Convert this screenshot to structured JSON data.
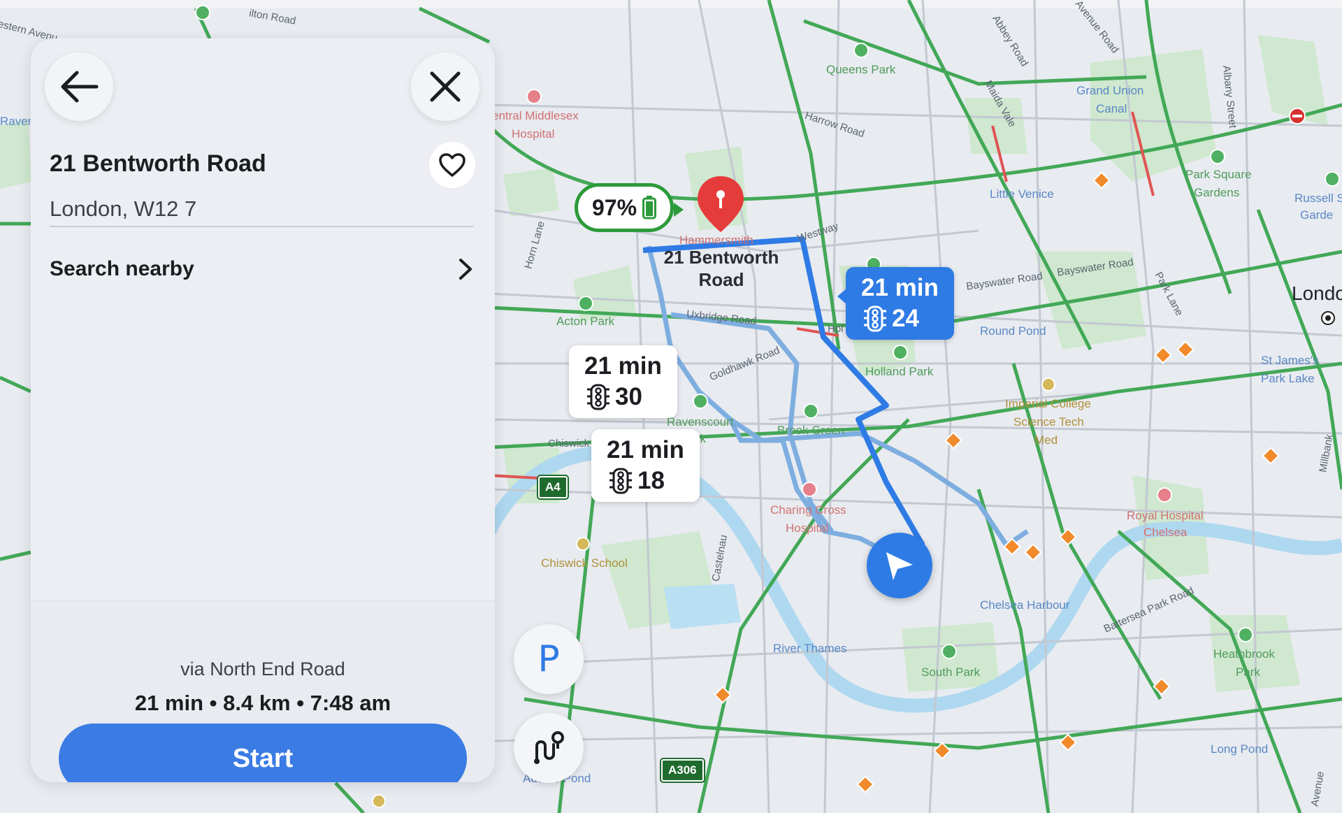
{
  "panel": {
    "address_title": "21 Bentworth Road",
    "address_sub": "London, W12 7",
    "search_nearby": "Search nearby",
    "via": "via North End Road",
    "summary": "21 min • 8.4 km • 7:48 am",
    "start": "Start"
  },
  "icons": {
    "back": "back-arrow-icon",
    "close": "close-icon",
    "favorite": "heart-icon",
    "chevron": "chevron-right-icon",
    "traffic": "traffic-light-icon",
    "parking": "parking-icon",
    "route_options": "route-options-icon",
    "position": "navigation-arrow-icon",
    "pin": "destination-pin-icon",
    "battery": "battery-icon"
  },
  "map": {
    "battery_percent": "97%",
    "destination_label": "21 Bentworth\nRoad",
    "routes": [
      {
        "time": "21 min",
        "lights": "24",
        "selected": true
      },
      {
        "time": "21 min",
        "lights": "30",
        "selected": false
      },
      {
        "time": "21 min",
        "lights": "18",
        "selected": false
      }
    ],
    "road_signs": [
      "A4",
      "A306"
    ],
    "fab_parking": "P",
    "labels": {
      "queens_park": "Queens Park",
      "central_middlesex": "entral Middlesex",
      "hospital1": "Hospital",
      "harrow_road": "Harrow Road",
      "grand_union": "Grand Union",
      "canal": "Canal",
      "park_square": "Park Square",
      "gardens": "Gardens",
      "russell": "Russell S",
      "garde": "Garde",
      "little_venice": "Little Venice",
      "westway": "Westway",
      "hammersmith": "Hammersmith",
      "bayswater1": "Bayswater Road",
      "bayswater2": "Bayswater Road",
      "london": "Londo",
      "acton_park": "Acton Park",
      "uxbridge": "Uxbridge Road",
      "round_pond": "Round Pond",
      "holland_park": "Holland Park",
      "st_james": "St James's",
      "park_lake": "Park Lake",
      "goldhawk": "Goldhawk Road",
      "ravenscourt": "Ravenscourt",
      "rk": "rk",
      "brook_green": "Brook Green",
      "imperial1": "Imperial College",
      "imperial2": "Science Tech",
      "imperial3": "Med",
      "chiswick": "Chiswick",
      "charing1": "Charing Cross",
      "charing2": "Hospital",
      "royal1": "Royal Hospital",
      "royal2": "Chelsea",
      "chiswick_school": "Chiswick School",
      "castelnau": "Castelnau",
      "chelsea_harbour": "Chelsea Harbour",
      "battersea": "Battersea Park Road",
      "river_thames": "River Thames",
      "south_park": "South Park",
      "heathbrook1": "Heathbrook",
      "heathbrook2": "Park",
      "long_pond": "Long Pond",
      "adams_pond": "Adams Pond",
      "abbey_road": "Abbey Road",
      "avenue_road": "Avenue Road",
      "maida_vale": "Maida Vale",
      "albany_street": "Albany Street",
      "park_lane": "Park Lane",
      "horn_lane": "Horn Lane",
      "western_ave": "estern Avenu",
      "ilton_road": "ilton Road",
      "raven": "Raven",
      "hol": "Hol",
      "millbank": "Millbank",
      "avenue": "Avenue"
    }
  }
}
